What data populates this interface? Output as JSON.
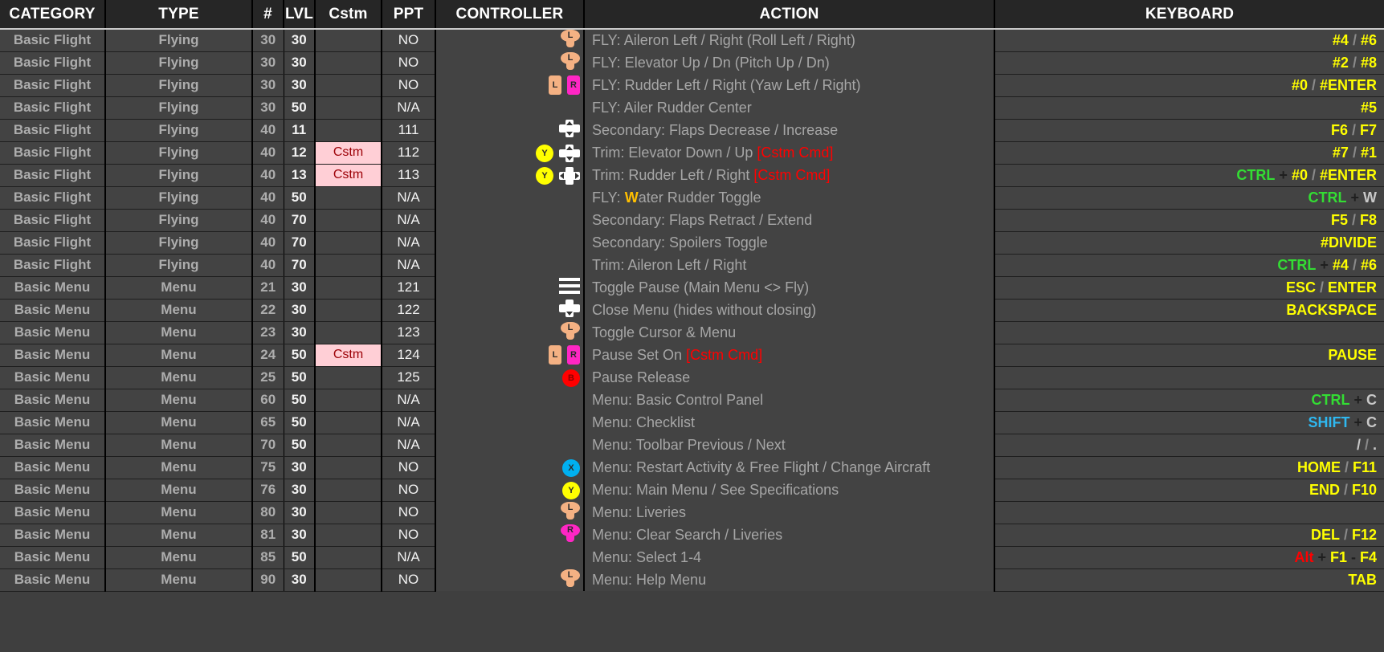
{
  "colors": {
    "header_bg": "#262626",
    "row_bg": "#434343",
    "cat_text": "#adadad",
    "keyboard_yellow": "#ffff00",
    "ctrl_green": "#33dd33",
    "shift_cyan": "#2fb8f0",
    "alt_red": "#ff0000",
    "cstm_bg": "#ffcfd6",
    "cstm_text": "#9c0006",
    "peach": "#f4b183",
    "magenta": "#ff26c4",
    "yellow_button": "#ffff00",
    "blue_button": "#00b0f0",
    "red_button": "#ff0000"
  },
  "header": {
    "category": "CATEGORY",
    "type": "TYPE",
    "num": "#",
    "lvl": "LVL",
    "cstm": "Cstm",
    "ppt": "PPT",
    "controller": "CONTROLLER",
    "action": "ACTION",
    "keyboard": "KEYBOARD"
  },
  "rows": [
    {
      "category": "Basic Flight",
      "type": "Flying",
      "num": "30",
      "lvl": "30",
      "cstm": "",
      "ppt": "NO",
      "icons": [
        {
          "kind": "stick",
          "color": "peach",
          "label": "L"
        }
      ],
      "action": "FLY: Aileron Left / Right (Roll Left / Right)",
      "keyboard": [
        {
          "t": "#4",
          "c": "yellow"
        },
        {
          "t": " / ",
          "c": "sep"
        },
        {
          "t": "#6",
          "c": "yellow"
        }
      ]
    },
    {
      "category": "Basic Flight",
      "type": "Flying",
      "num": "30",
      "lvl": "30",
      "cstm": "",
      "ppt": "NO",
      "icons": [
        {
          "kind": "stick",
          "color": "peach",
          "label": "L"
        }
      ],
      "action": "FLY: Elevator Up / Dn (Pitch Up / Dn)",
      "keyboard": [
        {
          "t": "#2",
          "c": "yellow"
        },
        {
          "t": " / ",
          "c": "sep"
        },
        {
          "t": "#8",
          "c": "yellow"
        }
      ]
    },
    {
      "category": "Basic Flight",
      "type": "Flying",
      "num": "30",
      "lvl": "30",
      "cstm": "",
      "ppt": "NO",
      "icons": [
        {
          "kind": "bumper",
          "color": "peach",
          "label": "L"
        },
        {
          "kind": "bumper",
          "color": "magenta",
          "label": "R"
        }
      ],
      "action": "FLY: Rudder Left / Right (Yaw Left / Right)",
      "keyboard": [
        {
          "t": "#0",
          "c": "yellow"
        },
        {
          "t": " / ",
          "c": "sep"
        },
        {
          "t": "#ENTER",
          "c": "yellow"
        }
      ]
    },
    {
      "category": "Basic Flight",
      "type": "Flying",
      "num": "30",
      "lvl": "50",
      "cstm": "",
      "ppt": "N/A",
      "icons": [],
      "action": "FLY: Ailer Rudder Center",
      "keyboard": [
        {
          "t": "#5",
          "c": "yellow"
        }
      ]
    },
    {
      "category": "Basic Flight",
      "type": "Flying",
      "num": "40",
      "lvl": "11",
      "cstm": "",
      "ppt": "111",
      "icons": [
        {
          "kind": "dpad",
          "dir": "ud"
        }
      ],
      "action": "Secondary: Flaps Decrease / Increase",
      "keyboard": [
        {
          "t": "F6",
          "c": "yellow"
        },
        {
          "t": " / ",
          "c": "sep"
        },
        {
          "t": "F7",
          "c": "yellow"
        }
      ]
    },
    {
      "category": "Basic Flight",
      "type": "Flying",
      "num": "40",
      "lvl": "12",
      "cstm": "Cstm",
      "ppt": "112",
      "icons": [
        {
          "kind": "face",
          "color": "yellow",
          "label": "Y"
        },
        {
          "kind": "dpad",
          "dir": "ud"
        }
      ],
      "action": "Trim: Elevator Down / Up ",
      "action_suffix": "[Cstm Cmd]",
      "keyboard": [
        {
          "t": "#7",
          "c": "yellow"
        },
        {
          "t": " / ",
          "c": "sep"
        },
        {
          "t": "#1",
          "c": "yellow"
        }
      ]
    },
    {
      "category": "Basic Flight",
      "type": "Flying",
      "num": "40",
      "lvl": "13",
      "cstm": "Cstm",
      "ppt": "113",
      "icons": [
        {
          "kind": "face",
          "color": "yellow",
          "label": "Y"
        },
        {
          "kind": "dpad",
          "dir": "lr"
        }
      ],
      "action": "Trim: Rudder Left / Right ",
      "action_suffix": "[Cstm Cmd]",
      "keyboard": [
        {
          "t": "CTRL",
          "c": "ctrl"
        },
        {
          "t": " + ",
          "c": "plus"
        },
        {
          "t": "#0",
          "c": "yellow"
        },
        {
          "t": " / ",
          "c": "sep"
        },
        {
          "t": "#ENTER",
          "c": "yellow"
        }
      ]
    },
    {
      "category": "Basic Flight",
      "type": "Flying",
      "num": "40",
      "lvl": "50",
      "cstm": "",
      "ppt": "N/A",
      "icons": [],
      "action": "FLY: Water Rudder Toggle",
      "action_hl": "W",
      "keyboard": [
        {
          "t": "CTRL",
          "c": "ctrl"
        },
        {
          "t": " + ",
          "c": "plus"
        },
        {
          "t": "W",
          "c": "plain"
        }
      ]
    },
    {
      "category": "Basic Flight",
      "type": "Flying",
      "num": "40",
      "lvl": "70",
      "cstm": "",
      "ppt": "N/A",
      "icons": [],
      "action": "Secondary: Flaps Retract / Extend",
      "keyboard": [
        {
          "t": "F5",
          "c": "yellow"
        },
        {
          "t": " / ",
          "c": "sep"
        },
        {
          "t": "F8",
          "c": "yellow"
        }
      ]
    },
    {
      "category": "Basic Flight",
      "type": "Flying",
      "num": "40",
      "lvl": "70",
      "cstm": "",
      "ppt": "N/A",
      "icons": [],
      "action": "Secondary: Spoilers Toggle",
      "keyboard": [
        {
          "t": "#DIVIDE",
          "c": "yellow"
        }
      ]
    },
    {
      "category": "Basic Flight",
      "type": "Flying",
      "num": "40",
      "lvl": "70",
      "cstm": "",
      "ppt": "N/A",
      "icons": [],
      "action": "Trim: Aileron Left / Right",
      "keyboard": [
        {
          "t": "CTRL",
          "c": "ctrl"
        },
        {
          "t": " + ",
          "c": "plus"
        },
        {
          "t": "#4",
          "c": "yellow"
        },
        {
          "t": " / ",
          "c": "sep"
        },
        {
          "t": "#6",
          "c": "yellow"
        }
      ]
    },
    {
      "category": "Basic Menu",
      "type": "Menu",
      "num": "21",
      "lvl": "30",
      "cstm": "",
      "ppt": "121",
      "icons": [
        {
          "kind": "burger"
        }
      ],
      "action": "Toggle Pause (Main Menu <> Fly)",
      "keyboard": [
        {
          "t": "ESC",
          "c": "yellow"
        },
        {
          "t": " / ",
          "c": "sep"
        },
        {
          "t": "ENTER",
          "c": "yellow"
        }
      ]
    },
    {
      "category": "Basic Menu",
      "type": "Menu",
      "num": "22",
      "lvl": "30",
      "cstm": "",
      "ppt": "122",
      "icons": [
        {
          "kind": "dpad",
          "dir": "d"
        }
      ],
      "action": "Close Menu (hides without closing)",
      "keyboard": [
        {
          "t": "BACKSPACE",
          "c": "yellow"
        }
      ]
    },
    {
      "category": "Basic Menu",
      "type": "Menu",
      "num": "23",
      "lvl": "30",
      "cstm": "",
      "ppt": "123",
      "icons": [
        {
          "kind": "stick",
          "color": "peach",
          "label": "L"
        }
      ],
      "action": "Toggle Cursor & Menu",
      "keyboard": []
    },
    {
      "category": "Basic Menu",
      "type": "Menu",
      "num": "24",
      "lvl": "50",
      "cstm": "Cstm",
      "ppt": "124",
      "icons": [
        {
          "kind": "bumper",
          "color": "peach",
          "label": "L"
        },
        {
          "kind": "bumper",
          "color": "magenta",
          "label": "R"
        }
      ],
      "action": "Pause Set On ",
      "action_suffix": "[Cstm Cmd]",
      "keyboard": [
        {
          "t": "PAUSE",
          "c": "yellow"
        }
      ]
    },
    {
      "category": "Basic Menu",
      "type": "Menu",
      "num": "25",
      "lvl": "50",
      "cstm": "",
      "ppt": "125",
      "icons": [
        {
          "kind": "face",
          "color": "red",
          "label": "B"
        }
      ],
      "action": "Pause Release",
      "keyboard": []
    },
    {
      "category": "Basic Menu",
      "type": "Menu",
      "num": "60",
      "lvl": "50",
      "cstm": "",
      "ppt": "N/A",
      "icons": [],
      "action": "Menu: Basic Control Panel",
      "keyboard": [
        {
          "t": "CTRL",
          "c": "ctrl"
        },
        {
          "t": " + ",
          "c": "plus"
        },
        {
          "t": "C",
          "c": "plain"
        }
      ]
    },
    {
      "category": "Basic Menu",
      "type": "Menu",
      "num": "65",
      "lvl": "50",
      "cstm": "",
      "ppt": "N/A",
      "icons": [],
      "action": "Menu: Checklist",
      "keyboard": [
        {
          "t": "SHIFT",
          "c": "shift"
        },
        {
          "t": " + ",
          "c": "plus"
        },
        {
          "t": "C",
          "c": "plain"
        }
      ]
    },
    {
      "category": "Basic Menu",
      "type": "Menu",
      "num": "70",
      "lvl": "50",
      "cstm": "",
      "ppt": "N/A",
      "icons": [],
      "action": "Menu: Toolbar Previous / Next",
      "keyboard": [
        {
          "t": "/",
          "c": "plain"
        },
        {
          "t": " / ",
          "c": "sep"
        },
        {
          "t": ".",
          "c": "plain"
        }
      ]
    },
    {
      "category": "Basic Menu",
      "type": "Menu",
      "num": "75",
      "lvl": "30",
      "cstm": "",
      "ppt": "NO",
      "icons": [
        {
          "kind": "face",
          "color": "blue",
          "label": "X"
        }
      ],
      "action": "Menu: Restart Activity & Free Flight / Change Aircraft",
      "keyboard": [
        {
          "t": "HOME",
          "c": "yellow"
        },
        {
          "t": " / ",
          "c": "sep"
        },
        {
          "t": "F11",
          "c": "yellow"
        }
      ]
    },
    {
      "category": "Basic Menu",
      "type": "Menu",
      "num": "76",
      "lvl": "30",
      "cstm": "",
      "ppt": "NO",
      "icons": [
        {
          "kind": "face",
          "color": "yellow",
          "label": "Y"
        }
      ],
      "action": "Menu: Main Menu / See Specifications",
      "keyboard": [
        {
          "t": "END",
          "c": "yellow"
        },
        {
          "t": " / ",
          "c": "sep"
        },
        {
          "t": "F10",
          "c": "yellow"
        }
      ]
    },
    {
      "category": "Basic Menu",
      "type": "Menu",
      "num": "80",
      "lvl": "30",
      "cstm": "",
      "ppt": "NO",
      "icons": [
        {
          "kind": "stick",
          "color": "peach",
          "label": "L"
        }
      ],
      "action": "Menu: Liveries",
      "keyboard": []
    },
    {
      "category": "Basic Menu",
      "type": "Menu",
      "num": "81",
      "lvl": "30",
      "cstm": "",
      "ppt": "NO",
      "icons": [
        {
          "kind": "stick",
          "color": "magenta",
          "label": "R"
        }
      ],
      "action": "Menu: Clear Search / Liveries",
      "keyboard": [
        {
          "t": "DEL",
          "c": "yellow"
        },
        {
          "t": " / ",
          "c": "sep"
        },
        {
          "t": "F12",
          "c": "yellow"
        }
      ]
    },
    {
      "category": "Basic Menu",
      "type": "Menu",
      "num": "85",
      "lvl": "50",
      "cstm": "",
      "ppt": "N/A",
      "icons": [],
      "action": "Menu: Select 1-4",
      "keyboard": [
        {
          "t": "Alt",
          "c": "alt"
        },
        {
          "t": " + ",
          "c": "plus"
        },
        {
          "t": "F1",
          "c": "yellow"
        },
        {
          "t": " - ",
          "c": "plus"
        },
        {
          "t": "F4",
          "c": "yellow"
        }
      ]
    },
    {
      "category": "Basic Menu",
      "type": "Menu",
      "num": "90",
      "lvl": "30",
      "cstm": "",
      "ppt": "NO",
      "icons": [
        {
          "kind": "stick",
          "color": "peach",
          "label": "L"
        }
      ],
      "action": "Menu: Help Menu",
      "keyboard": [
        {
          "t": "TAB",
          "c": "yellow"
        }
      ]
    }
  ]
}
